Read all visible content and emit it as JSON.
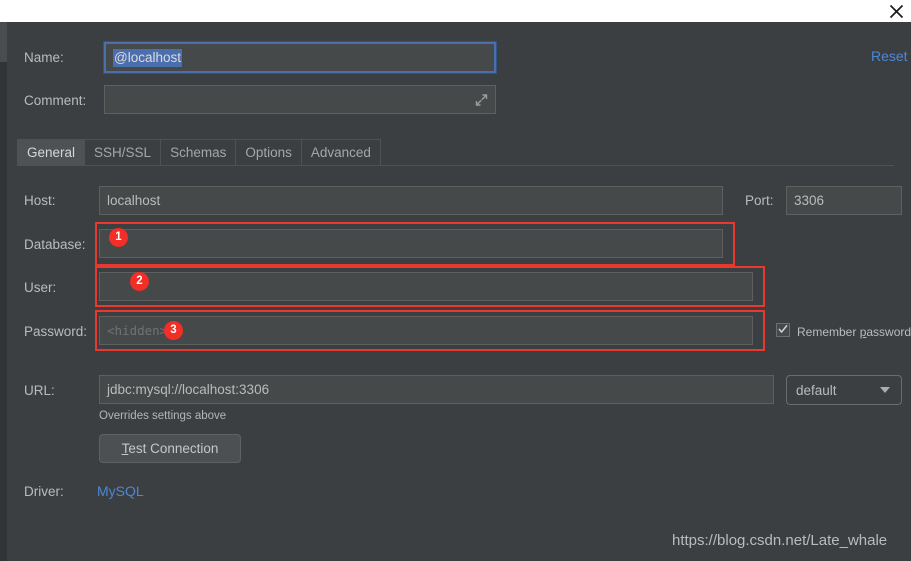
{
  "window": {
    "close_icon": "close-icon",
    "reset_label": "Reset"
  },
  "form": {
    "name_label": "Name:",
    "name_value": "@localhost",
    "comment_label": "Comment:",
    "comment_value": "",
    "comment_expand_icon": "expand-diagonal-icon",
    "host_label": "Host:",
    "host_value": "localhost",
    "port_label": "Port:",
    "port_value": "3306",
    "database_label": "Database:",
    "database_value": "",
    "user_label": "User:",
    "user_value": "",
    "password_label": "Password:",
    "password_placeholder": "<hidden>",
    "remember_password_label_pre": "Remember ",
    "remember_password_label_key": "p",
    "remember_password_label_post": "assword",
    "remember_password_checked": true,
    "url_label": "URL:",
    "url_value": "jdbc:mysql://localhost:3306",
    "url_hint": "Overrides settings above",
    "combo_value": "default",
    "test_connection_key": "T",
    "test_connection_rest": "est Connection",
    "driver_label": "Driver:",
    "driver_value": "MySQL"
  },
  "tabs": [
    {
      "label": "General",
      "active": true
    },
    {
      "label": "SSH/SSL",
      "active": false
    },
    {
      "label": "Schemas",
      "active": false
    },
    {
      "label": "Options",
      "active": false
    },
    {
      "label": "Advanced",
      "active": false
    }
  ],
  "annotations": [
    {
      "badge": "1",
      "target": "database-field"
    },
    {
      "badge": "2",
      "target": "user-field"
    },
    {
      "badge": "3",
      "target": "password-field"
    }
  ],
  "watermark": "https://blog.csdn.net/Late_whale",
  "colors": {
    "accent_link": "#4b87d6",
    "annotation_red": "#e8392f",
    "badge_red": "#f22e26",
    "selection_blue": "#4b6eaf",
    "panel_bg": "#3c3f41",
    "field_bg": "#45494a"
  }
}
